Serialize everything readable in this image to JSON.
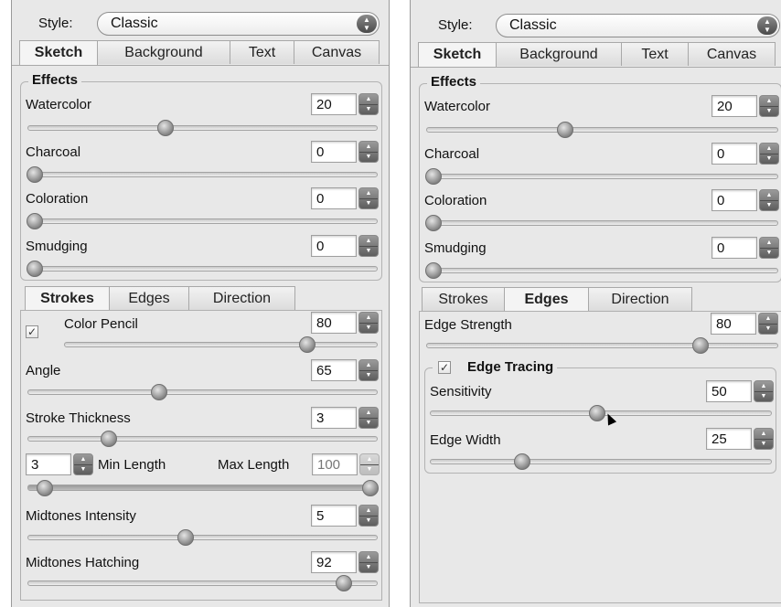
{
  "left": {
    "style_label": "Style:",
    "style_value": "Classic",
    "tabs": [
      "Sketch",
      "Background",
      "Text",
      "Canvas"
    ],
    "active_tab": "Sketch",
    "effects": {
      "title": "Effects",
      "watercolor": {
        "label": "Watercolor",
        "value": "20",
        "level": 0.39
      },
      "charcoal": {
        "label": "Charcoal",
        "value": "0",
        "level": 0.0
      },
      "coloration": {
        "label": "Coloration",
        "value": "0",
        "level": 0.0
      },
      "smudging": {
        "label": "Smudging",
        "value": "0",
        "level": 0.0
      }
    },
    "subtabs": [
      "Strokes",
      "Edges",
      "Direction"
    ],
    "active_subtab": "Strokes",
    "strokes": {
      "color_pencil": {
        "label": "Color Pencil",
        "checked": true,
        "check_glyph": "✓",
        "value": "80",
        "level": 0.79
      },
      "angle": {
        "label": "Angle",
        "value": "65",
        "level": 0.37
      },
      "stroke_thickness": {
        "label": "Stroke Thickness",
        "value": "3",
        "level": 0.22
      },
      "min_length": {
        "label": "Min Length",
        "value": "3",
        "level": 0.03
      },
      "max_length": {
        "label": "Max Length",
        "value": "100",
        "level": 1.0
      },
      "midtones_intensity": {
        "label": "Midtones Intensity",
        "value": "5",
        "level": 0.45
      },
      "midtones_hatching": {
        "label": "Midtones Hatching",
        "value": "92",
        "level": 0.92
      }
    }
  },
  "right": {
    "style_label": "Style:",
    "style_value": "Classic",
    "tabs": [
      "Sketch",
      "Background",
      "Text",
      "Canvas"
    ],
    "active_tab": "Sketch",
    "effects": {
      "title": "Effects",
      "watercolor": {
        "label": "Watercolor",
        "value": "20",
        "level": 0.39
      },
      "charcoal": {
        "label": "Charcoal",
        "value": "0",
        "level": 0.0
      },
      "coloration": {
        "label": "Coloration",
        "value": "0",
        "level": 0.0
      },
      "smudging": {
        "label": "Smudging",
        "value": "0",
        "level": 0.0
      }
    },
    "subtabs": [
      "Strokes",
      "Edges",
      "Direction"
    ],
    "active_subtab": "Edges",
    "edges": {
      "edge_strength": {
        "label": "Edge Strength",
        "value": "80",
        "level": 0.79
      },
      "edge_tracing": {
        "label": "Edge Tracing",
        "checked": true,
        "check_glyph": "✓"
      },
      "sensitivity": {
        "label": "Sensitivity",
        "value": "50",
        "level": 0.49
      },
      "edge_width": {
        "label": "Edge Width",
        "value": "25",
        "level": 0.26
      }
    }
  },
  "colors": {
    "panel_bg": "#e8e8e8",
    "stepper": "#5d5d5d",
    "knob": "#7e7e7e"
  },
  "icons": {
    "popup_arrows": "up-down-arrows-icon",
    "stepper": "stepper-arrows-icon",
    "checkbox": "checkmark-icon",
    "pointer": "mouse-cursor-icon"
  },
  "glyphs": {
    "up": "▲",
    "down": "▼"
  }
}
